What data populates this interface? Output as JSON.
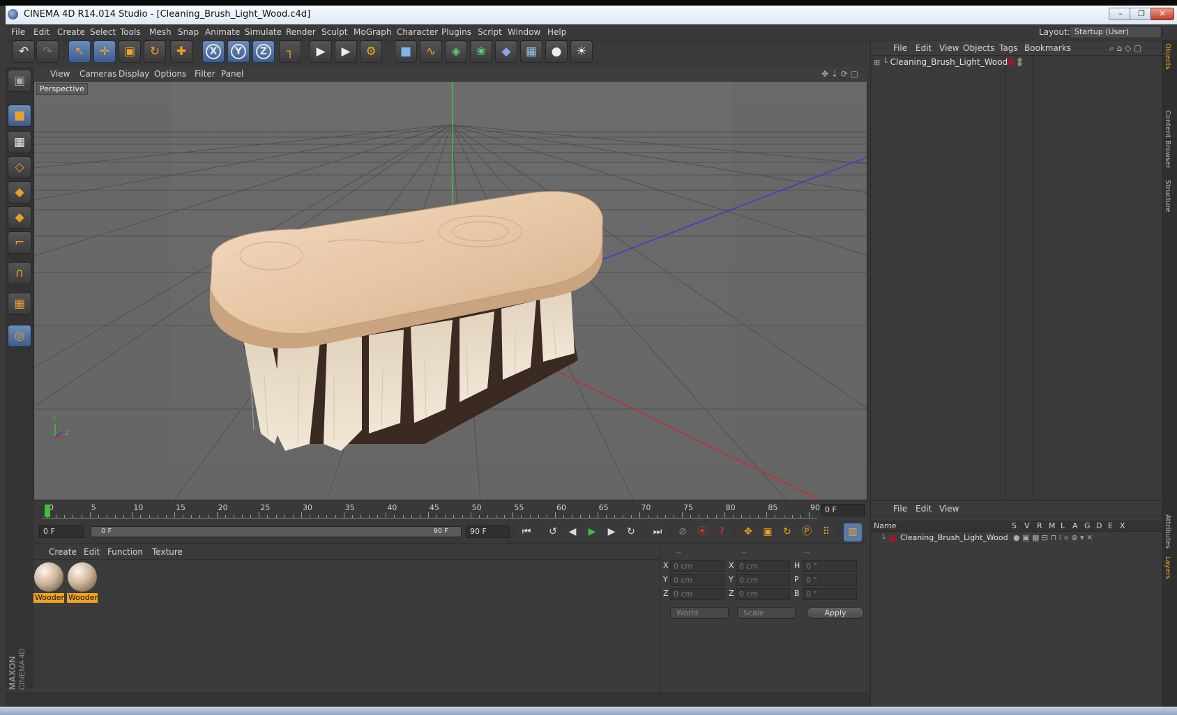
{
  "window": {
    "title": "CINEMA 4D R14.014 Studio - [Cleaning_Brush_Light_Wood.c4d]",
    "minimize": "–",
    "restore": "❐",
    "close": "✕"
  },
  "menu": [
    "File",
    "Edit",
    "Create",
    "Select",
    "Tools",
    "Mesh",
    "Snap",
    "Animate",
    "Simulate",
    "Render",
    "Sculpt",
    "MoGraph",
    "Character",
    "Plugins",
    "Script",
    "Window",
    "Help"
  ],
  "layout": {
    "label": "Layout:",
    "value": "Startup (User)"
  },
  "toolbar": {
    "undo": "↶",
    "redo": "↷",
    "select": "↖",
    "move": "✛",
    "scale": "▣",
    "rotate": "↻",
    "add": "✚",
    "x": "X",
    "y": "Y",
    "z": "Z",
    "coord": "┐",
    "render_view": "▶",
    "render": "▶",
    "render_settings": "⚙",
    "cube": "■",
    "spline": "∿",
    "nurbs": "◈",
    "array": "❀",
    "deformer": "◆",
    "floor": "▦",
    "camera": "●",
    "light": "☀"
  },
  "leftbar": [
    "▣",
    "■",
    "▦",
    "◇",
    "◆",
    "◆",
    "⌐",
    "∩",
    "▦",
    "◎"
  ],
  "viewport": {
    "menu": [
      "View",
      "Cameras",
      "Display",
      "Options",
      "Filter",
      "Panel"
    ],
    "label": "Perspective",
    "axes": {
      "y": "Y",
      "z": "Z"
    }
  },
  "objects": {
    "menu": [
      "File",
      "Edit",
      "View",
      "Objects",
      "Tags",
      "Bookmarks"
    ],
    "item": "Cleaning_Brush_Light_Wood"
  },
  "right_tabs": [
    "Objects",
    "Content Browser",
    "Structure",
    "Attributes",
    "Layers"
  ],
  "timeline": {
    "ticks": [
      "0",
      "5",
      "10",
      "15",
      "20",
      "25",
      "30",
      "35",
      "40",
      "45",
      "50",
      "55",
      "60",
      "65",
      "70",
      "75",
      "80",
      "85",
      "90"
    ],
    "current_frame": "0 F",
    "current_frame_fraction": 0
  },
  "transport": {
    "start": "0 F",
    "range_start": "0 F",
    "range_end": "90 F",
    "end": "90 F"
  },
  "materials": {
    "menu": [
      "Create",
      "Edit",
      "Function",
      "Texture"
    ],
    "items": [
      "Wooden",
      "Wooden"
    ]
  },
  "coords": {
    "headers": [
      "--",
      "--",
      "--"
    ],
    "rows": [
      {
        "l1": "X",
        "v1": "0 cm",
        "l2": "X",
        "v2": "0 cm",
        "l3": "H",
        "v3": "0 °"
      },
      {
        "l1": "Y",
        "v1": "0 cm",
        "l2": "Y",
        "v2": "0 cm",
        "l3": "P",
        "v3": "0 °"
      },
      {
        "l1": "Z",
        "v1": "0 cm",
        "l2": "Z",
        "v2": "0 cm",
        "l3": "B",
        "v3": "0 °"
      }
    ],
    "mode": "World",
    "scale": "Scale",
    "apply": "Apply"
  },
  "layers": {
    "menu": [
      "File",
      "Edit",
      "View"
    ],
    "columns": [
      "Name",
      "S",
      "V",
      "R",
      "M",
      "L",
      "A",
      "G",
      "D",
      "E",
      "X"
    ],
    "item": "Cleaning_Brush_Light_Wood"
  },
  "brand": {
    "line1": "MAXON",
    "line2": "CINEMA 4D"
  },
  "colors": {
    "accent": "#f0a221",
    "selected": "#4f74a8",
    "layer": "#8b1f2f"
  }
}
